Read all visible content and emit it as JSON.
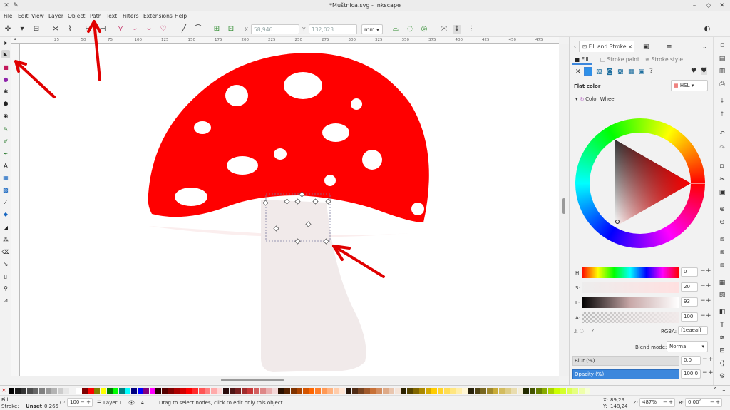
{
  "window": {
    "title": "*Muštnica.svg - Inkscape"
  },
  "menu": [
    "File",
    "Edit",
    "View",
    "Layer",
    "Object",
    "Path",
    "Text",
    "Filters",
    "Extensions",
    "Help"
  ],
  "toolbar": {
    "x_label": "X:",
    "x_value": "58,946",
    "y_label": "Y:",
    "y_value": "132,023",
    "unit": "mm"
  },
  "ruler": {
    "top_ticks": [
      "25",
      "50",
      "75",
      "100",
      "125",
      "150",
      "175",
      "200",
      "225",
      "250",
      "275",
      "300",
      "325",
      "350",
      "375",
      "400",
      "425",
      "450",
      "475"
    ]
  },
  "dock": {
    "tabs": [
      {
        "label": "Fill and Stroke",
        "close": "×"
      }
    ],
    "subtabs": [
      "Fill",
      "Stroke paint",
      "Stroke style"
    ],
    "flat_color": "Flat color",
    "color_mode": "HSL",
    "color_wheel_label": "Color Wheel",
    "sliders": [
      {
        "label": "H:",
        "value": "0"
      },
      {
        "label": "S:",
        "value": "20"
      },
      {
        "label": "L:",
        "value": "93"
      },
      {
        "label": "A:",
        "value": "100"
      }
    ],
    "rgba_label": "RGBA:",
    "rgba_value": "f1eaeaff",
    "blend_label": "Blend mode:",
    "blend_value": "Normal",
    "blur_label": "Blur (%)",
    "blur_value": "0,0",
    "opacity_label": "Opacity (%)",
    "opacity_value": "100,0"
  },
  "status": {
    "fill_label": "Fill:",
    "stroke_label": "Stroke:",
    "stroke_value": "Unset",
    "stroke_width": "0,265",
    "o_label": "O:",
    "o_value": "100",
    "layer": "Layer 1",
    "message": "Drag to select nodes, click to edit only this object",
    "x_label": "X:",
    "x_value": "89,29",
    "y_label": "Y:",
    "y_value": "148,24",
    "z_label": "Z:",
    "z_value": "487%",
    "r_label": "R:",
    "r_value": "0,00°"
  },
  "colors": {
    "cap": "#ff0000",
    "stem": "#f1eaea",
    "stem_shadow": "#fceaea",
    "annotation": "#e00000",
    "accent": "#3c87dc"
  },
  "icons": {
    "app": "inkscape-icon",
    "pin": "pin-icon"
  }
}
